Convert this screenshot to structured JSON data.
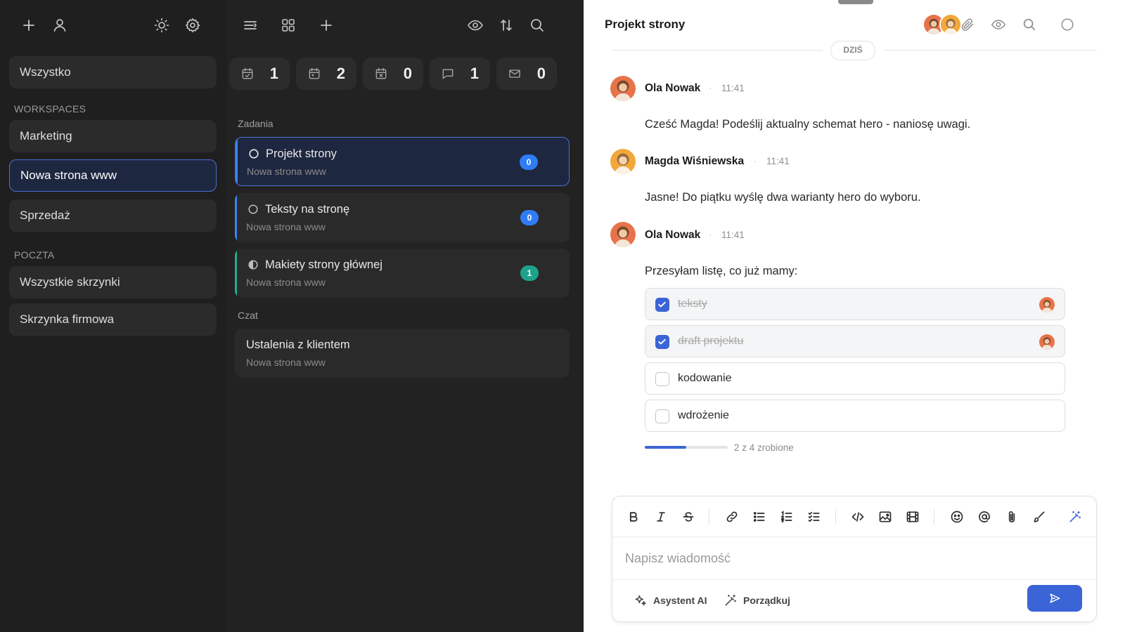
{
  "sidebar": {
    "all_label": "Wszystko",
    "workspaces_header": "WORKSPACES",
    "workspaces": [
      "Marketing",
      "Nowa strona www",
      "Sprzedaż"
    ],
    "mail_header": "POCZTA",
    "mail": [
      "Wszystkie skrzynki",
      "Skrzynka firmowa"
    ]
  },
  "counters": [
    {
      "icon": "calendar-check-icon",
      "value": "1"
    },
    {
      "icon": "calendar-icon",
      "value": "2"
    },
    {
      "icon": "calendar-x-icon",
      "value": "0"
    },
    {
      "icon": "chat-bubble-icon",
      "value": "1"
    },
    {
      "icon": "mail-icon",
      "value": "0"
    }
  ],
  "tasks_header": "Zadania",
  "tasks": [
    {
      "title": "Projekt strony",
      "subtitle": "Nowa strona www",
      "badge": "0",
      "status": "open",
      "accent": "#3b82f6",
      "badge_color": "#2f7cf5"
    },
    {
      "title": "Teksty na stronę",
      "subtitle": "Nowa strona www",
      "badge": "0",
      "status": "open",
      "accent": "#3b82f6",
      "badge_color": "#2f7cf5"
    },
    {
      "title": "Makiety strony głównej",
      "subtitle": "Nowa strona www",
      "badge": "1",
      "status": "half",
      "accent": "#1fae8e",
      "badge_color": "#1fa28a"
    }
  ],
  "chat_header": "Czat",
  "chats": [
    {
      "title": "Ustalenia z klientem",
      "subtitle": "Nowa strona www"
    }
  ],
  "conversation": {
    "title": "Projekt strony",
    "date_label": "DZIŚ",
    "messages": [
      {
        "author": "Ola Nowak",
        "time": "11:41",
        "text": "Cześć Magda! Podeślij aktualny schemat hero - naniosę uwagi."
      },
      {
        "author": "Magda Wiśniewska",
        "time": "11:41",
        "text": "Jasne! Do piątku wyślę dwa warianty hero do wyboru."
      },
      {
        "author": "Ola Nowak",
        "time": "11:41",
        "text": "Przesyłam listę, co już mamy:"
      }
    ],
    "checklist": [
      {
        "label": "teksty",
        "done": true
      },
      {
        "label": "draft projektu",
        "done": true
      },
      {
        "label": "kodowanie",
        "done": false
      },
      {
        "label": "wdrożenie",
        "done": false
      }
    ],
    "progress_text": "2 z 4 zrobione",
    "progress_fraction": 0.5
  },
  "composer": {
    "placeholder": "Napisz wiadomość",
    "ai_label": "Asystent AI",
    "tidy_label": "Porządkuj"
  },
  "colors": {
    "accent": "#3b64d6",
    "sidebar_bg": "#1f1f1f",
    "middle_bg": "#222222",
    "active_border": "#4a6fd1"
  }
}
